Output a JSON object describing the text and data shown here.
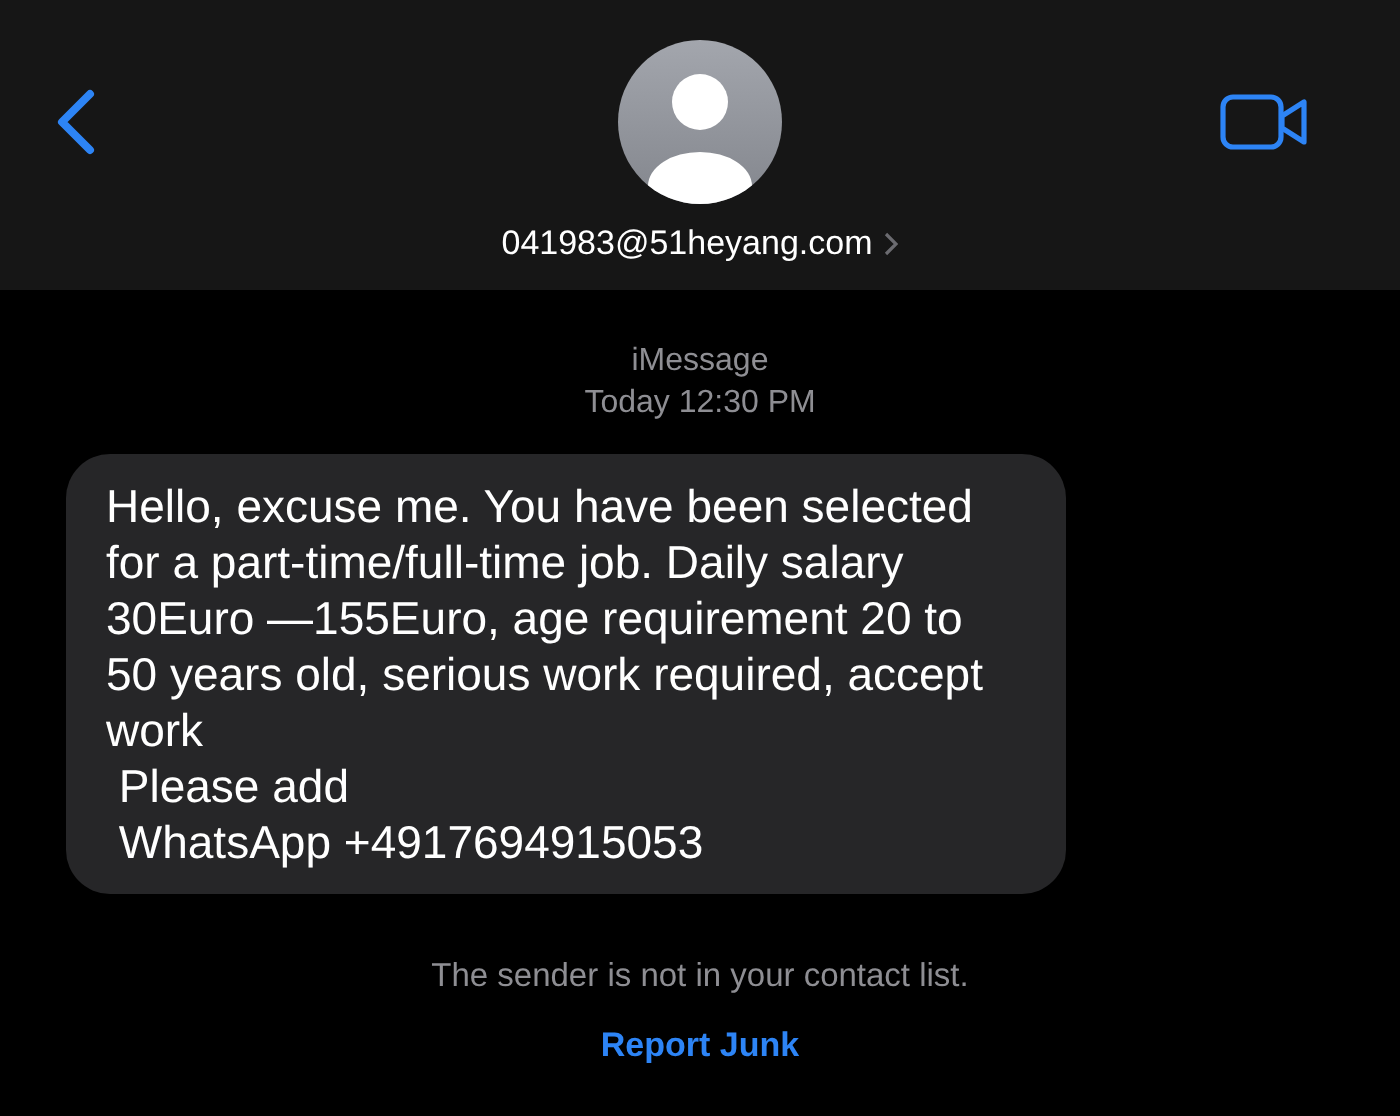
{
  "header": {
    "contact": "041983@51heyang.com"
  },
  "conversation": {
    "service": "iMessage",
    "timestamp": "Today 12:30 PM"
  },
  "messages": [
    {
      "kind": "incoming",
      "text": "Hello, excuse me. You have been selected for a part-time/full-time job. Daily salary 30Euro —155Euro, age requirement 20 to 50 years old, serious work required, accept work\n Please add\n WhatsApp +4917694915053"
    }
  ],
  "footer": {
    "notice": "The sender is not in your contact list.",
    "action": "Report Junk"
  }
}
